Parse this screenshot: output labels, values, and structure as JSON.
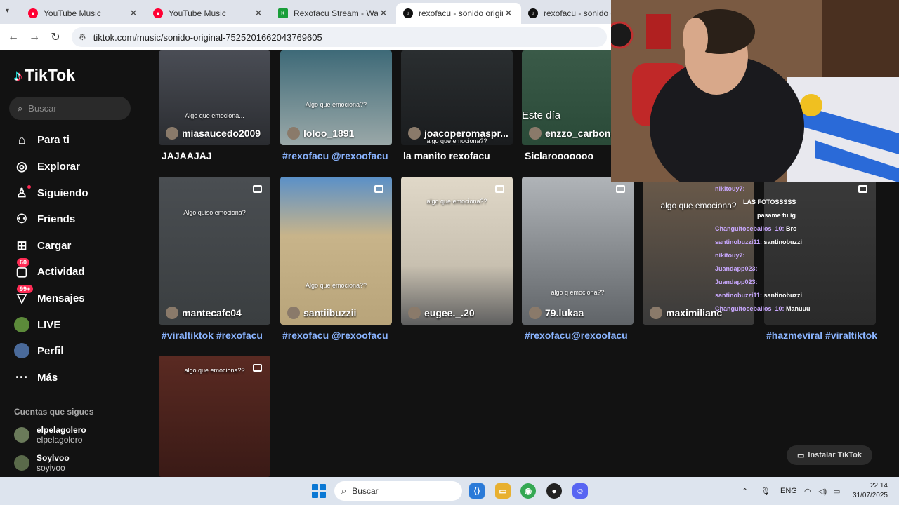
{
  "browser": {
    "tabs": [
      {
        "title": "YouTube Music",
        "favicon": "youtube-music-icon",
        "color": "#ff0033",
        "active": false
      },
      {
        "title": "YouTube Music",
        "favicon": "youtube-music-icon",
        "color": "#ff0033",
        "active": false
      },
      {
        "title": "Rexofacu Stream - Watch L",
        "favicon": "kick-icon",
        "color": "#1a9e3a",
        "active": false
      },
      {
        "title": "rexofacu - sonido original",
        "favicon": "tiktok-icon",
        "color": "#111111",
        "active": true
      },
      {
        "title": "rexofacu - sonido origi",
        "favicon": "tiktok-icon",
        "color": "#111111",
        "active": false
      }
    ],
    "url": "tiktok.com/music/sonido-original-7525201662043769605"
  },
  "sidebar": {
    "logo": "TikTok",
    "search_placeholder": "Buscar",
    "nav": [
      {
        "label": "Para ti",
        "icon": "home-icon"
      },
      {
        "label": "Explorar",
        "icon": "compass-icon"
      },
      {
        "label": "Siguiendo",
        "icon": "user-follow-icon"
      },
      {
        "label": "Friends",
        "icon": "friends-icon"
      },
      {
        "label": "Cargar",
        "icon": "upload-icon"
      },
      {
        "label": "Actividad",
        "icon": "activity-icon",
        "badge": "60"
      },
      {
        "label": "Mensajes",
        "icon": "message-icon",
        "badge": "99+"
      },
      {
        "label": "LIVE",
        "icon": "live-icon"
      },
      {
        "label": "Perfil",
        "icon": "profile-icon"
      },
      {
        "label": "Más",
        "icon": "more-icon"
      }
    ],
    "following_title": "Cuentas que sigues",
    "following": [
      {
        "name": "elpelagolero",
        "handle": "elpelagolero"
      },
      {
        "name": "Soylvoo",
        "handle": "soyivoo"
      }
    ]
  },
  "videos": [
    {
      "user": "miasaucedo2009",
      "caption": "Algo que emociona...",
      "desc": "JAJAAJAJ",
      "tag": false
    },
    {
      "user": "loloo_1891",
      "caption": "Algo que emociona??",
      "desc": "#rexofacu @rexoofacu",
      "tag": true
    },
    {
      "user": "joacoperomaspr...",
      "caption": "algo que emociona??",
      "desc": "la manito rexofacu",
      "tag": false
    },
    {
      "user": "enzzo_carbone",
      "caption": "Este día",
      "desc": "Siclarooooooo",
      "tag": false
    },
    {
      "user": "mantecafc04",
      "caption": "Algo quiso emociona?",
      "desc": "#viraltiktok #rexofacu",
      "tag": true
    },
    {
      "user": "santiibuzzii",
      "caption": "Algo que emociona??",
      "desc": "#rexofacu @rexoofacu",
      "tag": true
    },
    {
      "user": "eugee._.20",
      "caption": "algo que emociona??",
      "desc": "",
      "tag": false
    },
    {
      "user": "79.lukaa",
      "caption": "algo q emociona??",
      "desc": "#rexofacu@rexoofacu",
      "tag": true
    },
    {
      "user": "maximilianc",
      "caption": "algo que emociona?",
      "desc": "",
      "tag": false
    },
    {
      "user": "",
      "caption": "",
      "desc": "#hazmeviral #viraltiktok",
      "tag": true
    },
    {
      "user": "",
      "caption": "algo que emociona??",
      "desc": "",
      "tag": false
    }
  ],
  "chat": [
    {
      "name": "nikitouy7:",
      "msg": ""
    },
    {
      "name": "",
      "msg": "LAS FOTOSSSSS"
    },
    {
      "name": "",
      "msg": "pasame tu ig"
    },
    {
      "name": "Changuitoceballos_10:",
      "msg": "Bro"
    },
    {
      "name": "santinobuzzi11:",
      "msg": "santinobuzzi"
    },
    {
      "name": "nikitouy7:",
      "msg": ""
    },
    {
      "name": "Juandapp023:",
      "msg": ""
    },
    {
      "name": "Juandapp023:",
      "msg": ""
    },
    {
      "name": "santinobuzzi11:",
      "msg": "santinobuzzi"
    },
    {
      "name": "Changuitoceballos_10:",
      "msg": "Manuuu"
    }
  ],
  "install_button": "Instalar TikTok",
  "taskbar": {
    "search": "Buscar",
    "lang": "ENG",
    "time": "22:14",
    "date": "31/07/2025"
  }
}
